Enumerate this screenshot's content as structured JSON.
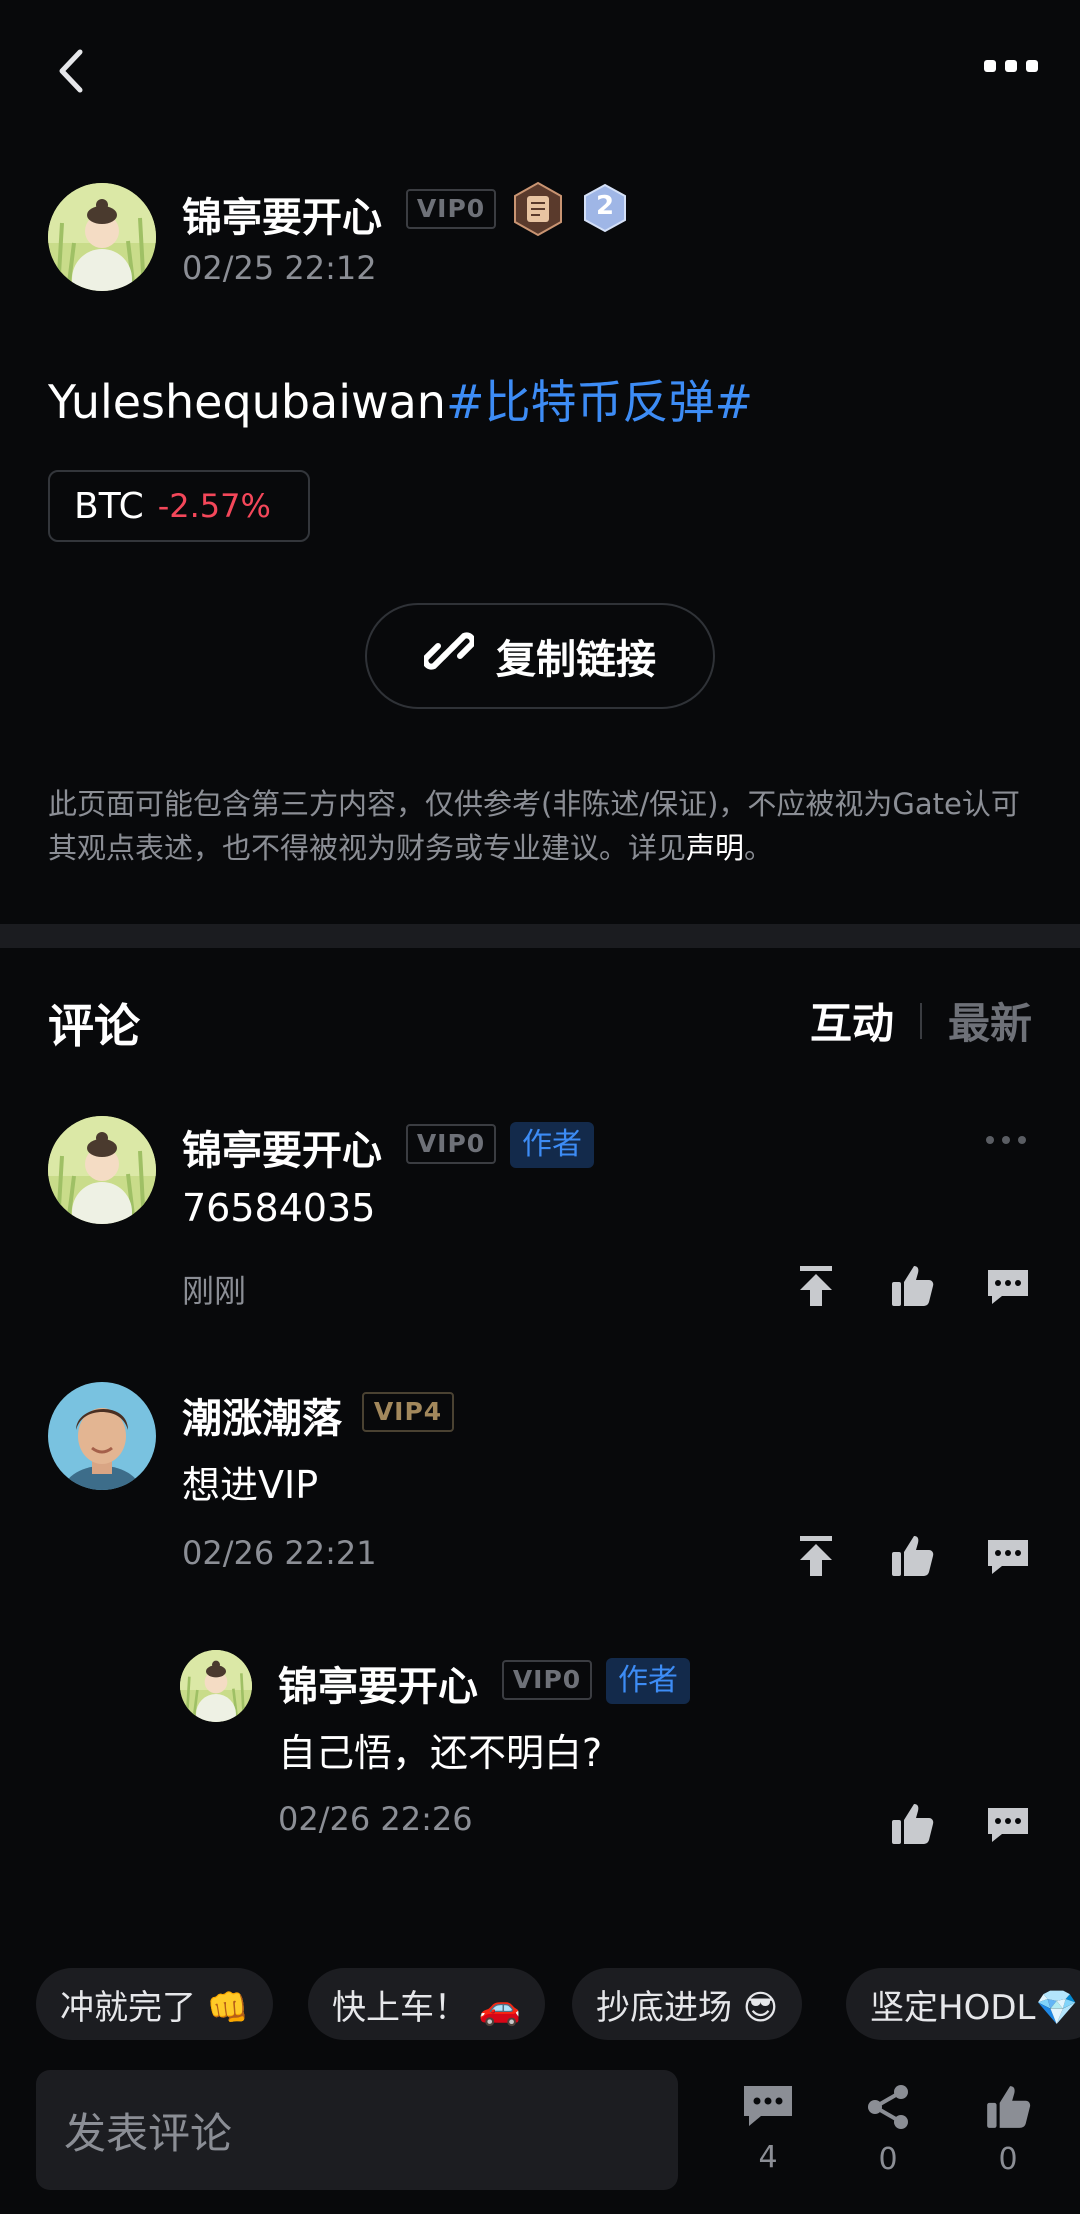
{
  "post": {
    "author_name": "锦亭要开心",
    "vip_label": "VIP0",
    "level_badge": "2",
    "time": "02/25 22:12",
    "text": "Yuleshequbaiwan",
    "hashtag": "#比特币反弹#",
    "coin_symbol": "BTC",
    "coin_change": "-2.57%",
    "copy_link_label": "复制链接",
    "disclaimer_text": "此页面可能包含第三方内容，仅供参考(非陈述/保证)，不应被视为Gate认可其观点表述，也不得被视为财务或专业建议。详见",
    "disclaimer_link": "声明",
    "disclaimer_end": "。"
  },
  "comments_section": {
    "title": "评论",
    "sort_active": "互动",
    "sort_inactive": "最新"
  },
  "comments": [
    {
      "author": "锦亭要开心",
      "vip": "VIP0",
      "tag": "作者",
      "text": "76584035",
      "time": "刚刚"
    },
    {
      "author": "潮涨潮落",
      "vip": "VIP4",
      "text": "想进VIP",
      "time": "02/26 22:21"
    },
    {
      "author": "锦亭要开心",
      "vip": "VIP0",
      "tag": "作者",
      "text": "自己悟，还不明白?",
      "time": "02/26 22:26"
    }
  ],
  "quick_replies": [
    "冲就完了 👊",
    "快上车！ 🚗",
    "抄底进场 😎",
    "坚定HODL💎"
  ],
  "bottom_bar": {
    "input_placeholder": "发表评论",
    "comment_count": "4",
    "share_count": "0",
    "like_count": "0"
  },
  "colors": {
    "background": "#08090b",
    "hashtag": "#3d8cf5",
    "negative": "#f4475a",
    "muted": "#8b8e95"
  }
}
